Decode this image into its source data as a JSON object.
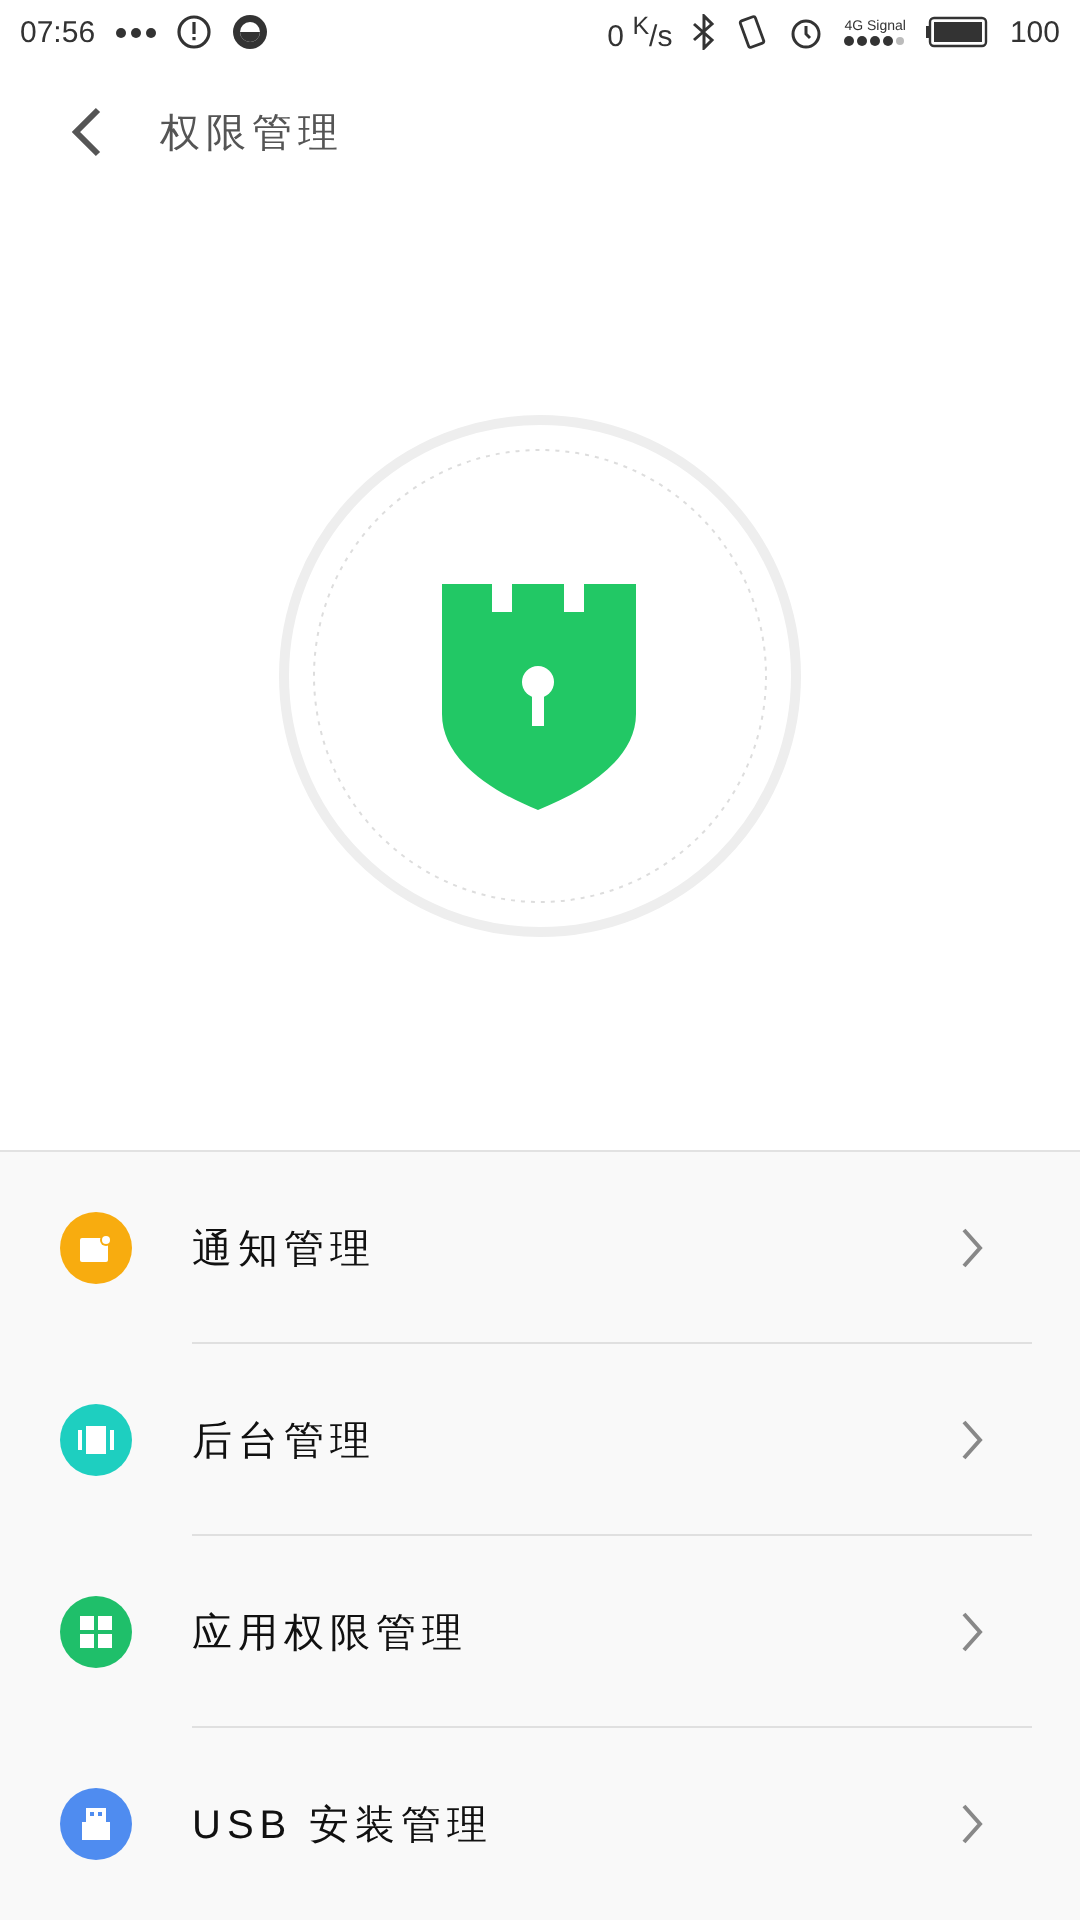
{
  "status_bar": {
    "time": "07:56",
    "speed": "0 $^{K}$/s",
    "network": "4G",
    "signal_label": "Signal",
    "battery": "100"
  },
  "header": {
    "title": "权限管理"
  },
  "items": [
    {
      "label": "通知管理",
      "kind": "notification",
      "color": "#f8ac0f"
    },
    {
      "label": "后台管理",
      "kind": "background",
      "color": "#1ecfc0"
    },
    {
      "label": "应用权限管理",
      "kind": "apps",
      "color": "#1fbf6a"
    },
    {
      "label": "USB 安装管理",
      "kind": "usb",
      "color": "#4f8cf0"
    }
  ]
}
